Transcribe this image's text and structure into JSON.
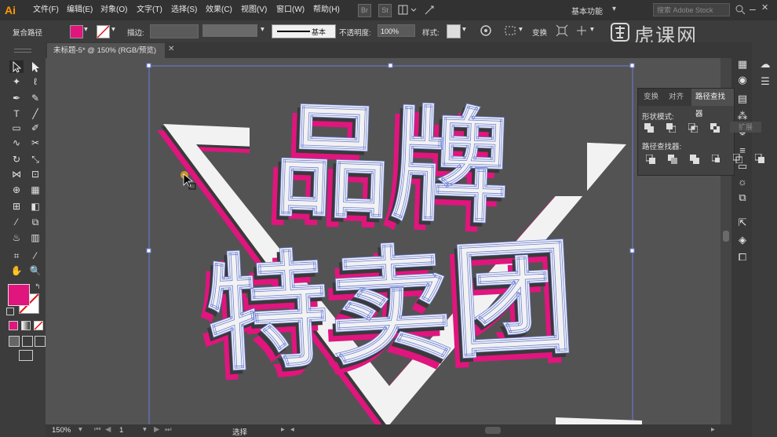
{
  "app": {
    "logo": "Ai"
  },
  "menu": {
    "items": [
      "文件(F)",
      "编辑(E)",
      "对象(O)",
      "文字(T)",
      "选择(S)",
      "效果(C)",
      "视图(V)",
      "窗口(W)",
      "帮助(H)"
    ],
    "app_buttons": [
      "Br",
      "St"
    ],
    "workspace": "基本功能",
    "stock_search_placeholder": "搜索 Adobe Stock"
  },
  "control_bar": {
    "selection_type": "复合路径",
    "fill_color": "#e0157e",
    "stroke_label": "描边:",
    "brush_label": "基本",
    "opacity_label": "不透明度:",
    "opacity_value": "100%",
    "style_label": "样式:",
    "transform_label": "变换"
  },
  "document": {
    "tab_title": "未标题-5* @ 150% (RGB/预览)"
  },
  "panel": {
    "tabs": [
      "变换",
      "对齐",
      "路径查找器"
    ],
    "active_tab": "路径查找器",
    "shape_modes_label": "形状模式:",
    "expand_button": "扩展",
    "pathfinders_label": "路径查找器:"
  },
  "status_bar": {
    "zoom": "150%",
    "artboard_number": "1",
    "tool_name": "选择"
  },
  "artwork": {
    "line1": "品牌",
    "line2": "特卖团",
    "colors": {
      "face": "#f2f2f2",
      "shadow": "#3a3a3a",
      "accent": "#e0157e",
      "selection": "#6b7fd7"
    }
  },
  "watermark": {
    "text": "虎课网"
  },
  "colors": {
    "ui_dark": "#323232",
    "ui_mid": "#3c3c3c",
    "canvas": "#535353",
    "fill_swatch": "#e0157e"
  }
}
